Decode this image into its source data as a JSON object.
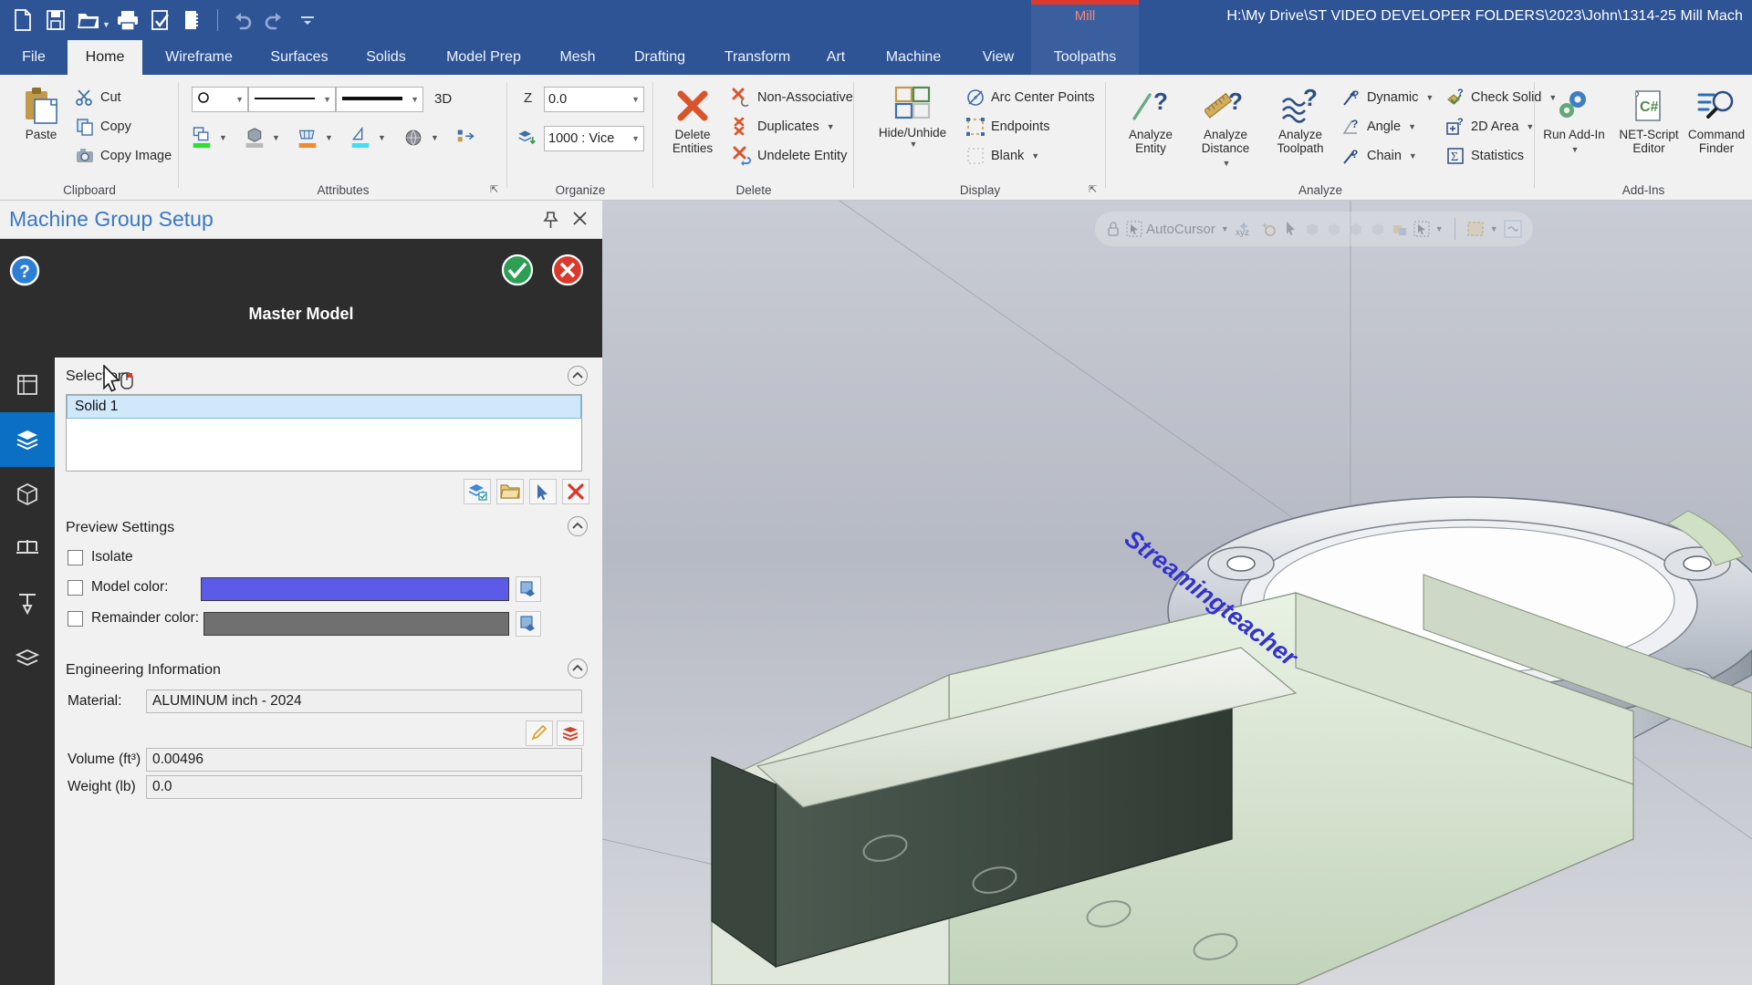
{
  "titlebar": {
    "file_path": "H:\\My Drive\\ST VIDEO DEVELOPER FOLDERS\\2023\\John\\1314-25 Mill Mach",
    "contextual_group": "Mill",
    "contextual_color": "#e03a2f",
    "quick_access": [
      {
        "name": "new-file-icon",
        "label": "New"
      },
      {
        "name": "save-icon",
        "label": "Save"
      },
      {
        "name": "open-folder-icon",
        "label": "Open"
      },
      {
        "name": "print-icon",
        "label": "Print"
      },
      {
        "name": "print-preview-icon",
        "label": "Print Preview"
      },
      {
        "name": "zoom-window-icon",
        "label": "Zoom Window"
      },
      {
        "name": "undo-icon",
        "label": "Undo"
      },
      {
        "name": "redo-icon",
        "label": "Redo"
      },
      {
        "name": "customize-qat-icon",
        "label": "Customize Quick Access Toolbar"
      }
    ]
  },
  "tabs": [
    {
      "label": "File",
      "active": false,
      "contextual": false
    },
    {
      "label": "Home",
      "active": true,
      "contextual": false
    },
    {
      "label": "Wireframe",
      "active": false,
      "contextual": false
    },
    {
      "label": "Surfaces",
      "active": false,
      "contextual": false
    },
    {
      "label": "Solids",
      "active": false,
      "contextual": false
    },
    {
      "label": "Model Prep",
      "active": false,
      "contextual": false
    },
    {
      "label": "Mesh",
      "active": false,
      "contextual": false
    },
    {
      "label": "Drafting",
      "active": false,
      "contextual": false
    },
    {
      "label": "Transform",
      "active": false,
      "contextual": false
    },
    {
      "label": "Art",
      "active": false,
      "contextual": false
    },
    {
      "label": "Machine",
      "active": false,
      "contextual": false
    },
    {
      "label": "View",
      "active": false,
      "contextual": false
    },
    {
      "label": "Toolpaths",
      "active": false,
      "contextual": true
    }
  ],
  "ribbon": {
    "groups": [
      {
        "name": "clipboard",
        "title": "Clipboard"
      },
      {
        "name": "attributes",
        "title": "Attributes"
      },
      {
        "name": "organize",
        "title": "Organize"
      },
      {
        "name": "delete",
        "title": "Delete"
      },
      {
        "name": "display",
        "title": "Display"
      },
      {
        "name": "analyze",
        "title": "Analyze"
      },
      {
        "name": "addins",
        "title": "Add-Ins"
      }
    ],
    "clipboard": {
      "paste": "Paste",
      "cut": "Cut",
      "copy": "Copy",
      "copy_image": "Copy Image"
    },
    "attributes": {
      "point_style": "",
      "line_style": "",
      "line_width": "",
      "depth_label": "3D"
    },
    "organize": {
      "z_label": "Z",
      "z_value": "0.0",
      "level_value": "1000 : Vice"
    },
    "delete": {
      "delete_entities": "Delete Entities",
      "non_associative": "Non-Associative",
      "duplicates": "Duplicates",
      "undelete_entity": "Undelete Entity"
    },
    "display": {
      "hide_unhide": "Hide/Unhide",
      "arc_center_points": "Arc Center Points",
      "endpoints": "Endpoints",
      "blank": "Blank"
    },
    "analyze": {
      "analyze_entity": "Analyze Entity",
      "analyze_distance": "Analyze Distance",
      "analyze_toolpath": "Analyze Toolpath",
      "dynamic": "Dynamic",
      "angle": "Angle",
      "chain": "Chain",
      "check_solid": "Check Solid",
      "area_2d": "2D Area",
      "statistics": "Statistics"
    },
    "addins": {
      "run_addin": "Run Add-In",
      "net_script_editor": "NET-Script Editor",
      "command_finder": "Command Finder"
    }
  },
  "panel": {
    "title": "Machine Group Setup",
    "header_label": "Master Model",
    "rail": [
      {
        "name": "rail-item-planes",
        "label": "Planes"
      },
      {
        "name": "rail-item-master-model",
        "label": "Master Model",
        "selected": true
      },
      {
        "name": "rail-item-stock",
        "label": "Stock Setup"
      },
      {
        "name": "rail-item-fixtures",
        "label": "Fixtures"
      },
      {
        "name": "rail-item-tooling",
        "label": "Tooling"
      },
      {
        "name": "rail-item-safety",
        "label": "Safety Zone"
      }
    ],
    "selection": {
      "section_title": "Selection",
      "items": [
        {
          "label": "Solid 1",
          "selected": true
        }
      ],
      "buttons": [
        {
          "name": "select-solids-button",
          "label": "Select solids"
        },
        {
          "name": "open-file-button",
          "label": "Open"
        },
        {
          "name": "pick-entity-button",
          "label": "Pick entity"
        },
        {
          "name": "clear-selection-button",
          "label": "Clear"
        }
      ]
    },
    "preview_settings": {
      "section_title": "Preview Settings",
      "isolate_label": "Isolate",
      "isolate_checked": false,
      "model_color_label": "Model color:",
      "model_color_checked": false,
      "model_color_value": "#5b5be8",
      "remainder_color_label": "Remainder color:",
      "remainder_color_checked": false,
      "remainder_color_value": "#707070"
    },
    "engineering_information": {
      "section_title": "Engineering Information",
      "material_label": "Material:",
      "material_value": "ALUMINUM inch - 2024",
      "volume_label": "Volume (ft³)",
      "volume_value": "0.00496",
      "weight_label": "Weight (lb)",
      "weight_value": "0.0",
      "edit_material_button": "Edit material",
      "material_library_button": "Material library"
    }
  },
  "viewport": {
    "toolbar": {
      "lock_label": "Lock",
      "autocursor_label": "AutoCursor",
      "xyz_label": "xyz",
      "items": [
        {
          "name": "lock-icon",
          "label": "Lock"
        },
        {
          "name": "autocursor-icon",
          "label": "AutoCursor"
        },
        {
          "name": "xyz-snap-icon",
          "label": "xyz"
        },
        {
          "name": "origin-snap-icon",
          "label": "Origin"
        },
        {
          "name": "arrow-select-icon",
          "label": "Select"
        },
        {
          "name": "solid-face-icon",
          "label": "Solid face"
        },
        {
          "name": "solid-edge-icon",
          "label": "Solid edge"
        },
        {
          "name": "solid-body-icon",
          "label": "Solid body"
        },
        {
          "name": "solid-feature-icon",
          "label": "Solid feature"
        },
        {
          "name": "surface-icon",
          "label": "Surface"
        },
        {
          "name": "window-select-icon",
          "label": "Window select"
        },
        {
          "name": "selection-mask-icon",
          "label": "Selection mask"
        },
        {
          "name": "analyze-quick-icon",
          "label": "Quick analyze"
        }
      ]
    },
    "watermark": "Streamingteacher"
  }
}
